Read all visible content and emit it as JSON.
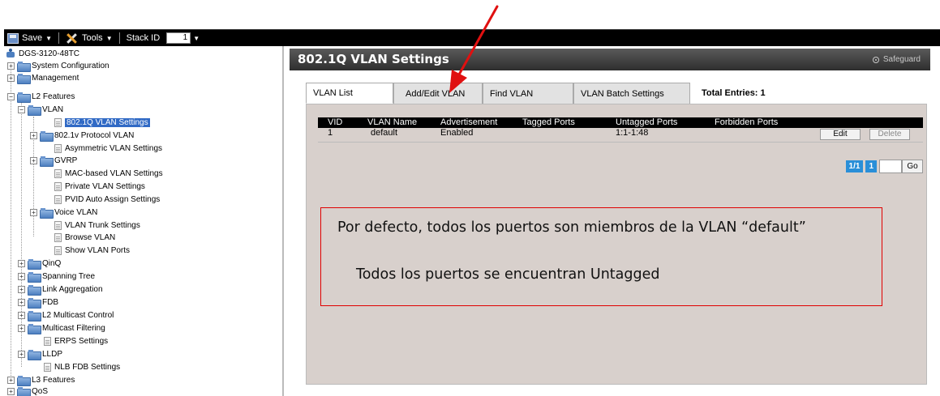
{
  "toolbar": {
    "save_label": "Save",
    "tools_label": "Tools",
    "stack_id_label": "Stack ID",
    "stack_id_value": "1"
  },
  "tree": {
    "root": "DGS-3120-48TC",
    "items": {
      "system_configuration": "System Configuration",
      "management": "Management",
      "l2_features": "L2 Features",
      "vlan": "VLAN",
      "vlan_8021q": "802.1Q VLAN Settings",
      "vlan_8021v": "802.1v Protocol VLAN",
      "asymmetric_vlan": "Asymmetric VLAN Settings",
      "gvrp": "GVRP",
      "mac_based_vlan": "MAC-based VLAN Settings",
      "private_vlan": "Private VLAN Settings",
      "pvid_auto_assign": "PVID Auto Assign Settings",
      "voice_vlan": "Voice VLAN",
      "vlan_trunk": "VLAN Trunk Settings",
      "browse_vlan": "Browse VLAN",
      "show_vlan_ports": "Show VLAN Ports",
      "qinq": "QinQ",
      "spanning_tree": "Spanning Tree",
      "link_aggregation": "Link Aggregation",
      "fdb": "FDB",
      "l2_multicast": "L2 Multicast Control",
      "multicast_filtering": "Multicast Filtering",
      "erps": "ERPS Settings",
      "lldp": "LLDP",
      "nlb_fdb": "NLB FDB Settings",
      "l3_features": "L3 Features",
      "qos": "QoS"
    }
  },
  "panel": {
    "title": "802.1Q VLAN Settings",
    "safeguard": "Safeguard",
    "tabs": {
      "vlan_list": "VLAN List",
      "add_edit_vlan": "Add/Edit VLAN",
      "find_vlan": "Find VLAN",
      "batch_settings": "VLAN Batch Settings"
    },
    "total_entries": "Total Entries: 1",
    "table": {
      "headers": {
        "vid": "VID",
        "vlan_name": "VLAN Name",
        "advertisement": "Advertisement",
        "tagged_ports": "Tagged Ports",
        "untagged_ports": "Untagged Ports",
        "forbidden_ports": "Forbidden Ports"
      },
      "row": {
        "vid": "1",
        "vlan_name": "default",
        "advertisement": "Enabled",
        "tagged_ports": "",
        "untagged_ports": "1:1-1:48",
        "forbidden_ports": ""
      },
      "edit_label": "Edit",
      "delete_label": "Delete"
    },
    "pager": {
      "page_of": "1/1",
      "page": "1",
      "go_label": "Go"
    }
  },
  "annotation": {
    "line1": "Por defecto, todos los puertos son miembros de la VLAN “default”",
    "line2": "Todos los puertos se encuentran Untagged",
    "accent_color": "#e00000"
  }
}
